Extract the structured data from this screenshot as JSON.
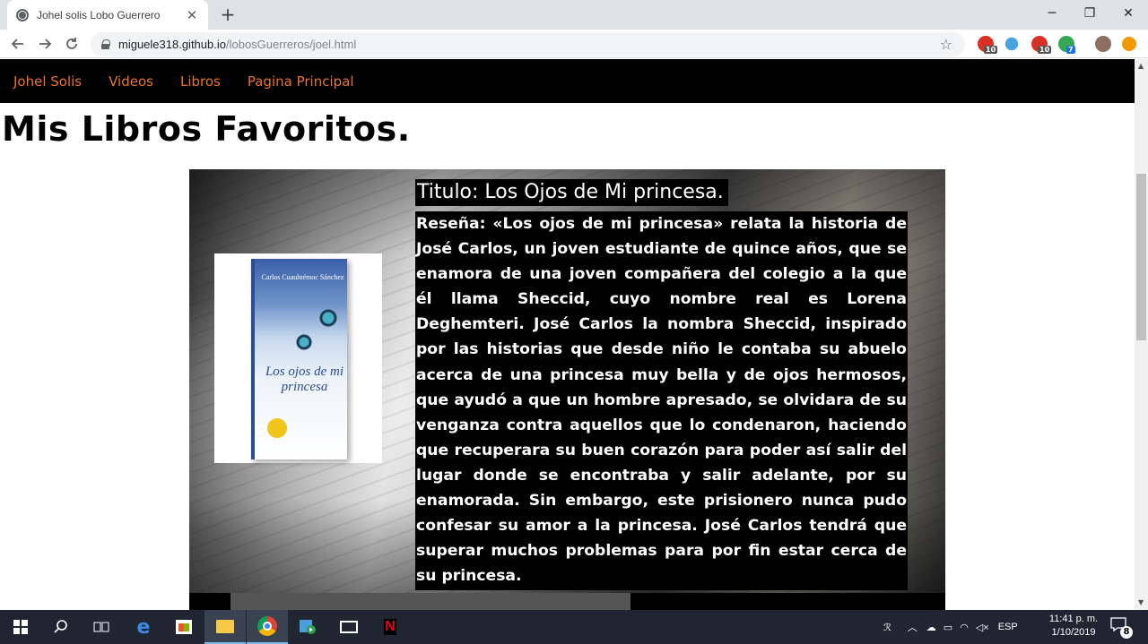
{
  "browser": {
    "tab_title": "Johel solis Lobo Guerrero",
    "tab_close": "✕",
    "new_tab": "+",
    "url_host": "miguele318.github.io",
    "url_path": "/lobosGuerreros/joel.html",
    "window_controls": {
      "minimize": "─",
      "maximize": "❐",
      "close": "✕"
    },
    "extension_badges": [
      "10",
      "10",
      "7"
    ]
  },
  "site": {
    "nav": [
      "Johel Solis",
      "Videos",
      "Libros",
      "Pagina Principal"
    ],
    "heading": "Mis Libros Favoritos.",
    "book": {
      "cover_author": "Carlos Cuauhtémoc Sánchez",
      "cover_title": "Los ojos de mi princesa",
      "title": "Titulo: Los Ojos de Mi princesa.",
      "review": "Reseña: «Los ojos de mi princesa» relata la historia de José Carlos, un joven estudiante de quince años, que se enamora de una joven compañera del colegio a la que él llama Sheccid, cuyo nombre real es Lorena Deghemteri. José Carlos la nombra Sheccid, inspirado por las historias que desde niño le contaba su abuelo acerca de una princesa muy bella y de ojos hermosos, que ayudó a que un hombre apresado, se olvidara de su venganza contra aquellos que lo condenaron, haciendo que recuperara su buen corazón para poder así salir del lugar donde se encontraba y salir adelante, por su enamorada. Sin embargo, este prisionero nunca pudo confesar su amor a la princesa. José Carlos tendrá que superar muchos problemas para por fin estar cerca de su princesa."
    }
  },
  "taskbar": {
    "tray_lang": "ESP",
    "clock_time": "11:41 p. m.",
    "clock_date": "1/10/2019",
    "notification_count": "8"
  },
  "colors": {
    "nav_link": "#e8742a",
    "nav_bg": "#000000",
    "taskbar_bg": "#1f2632",
    "tab_strip": "#dee1e6"
  },
  "icons": [
    "globe-icon",
    "back-arrow-icon",
    "forward-arrow-icon",
    "reload-icon",
    "lock-icon",
    "star-icon",
    "windows-start-icon",
    "search-icon",
    "task-view-icon",
    "edge-icon",
    "store-icon",
    "file-explorer-icon",
    "chrome-icon",
    "media-player-icon",
    "mail-icon",
    "netflix-icon",
    "wifi-icon",
    "volume-icon",
    "battery-icon",
    "onedrive-icon",
    "notification-icon"
  ]
}
